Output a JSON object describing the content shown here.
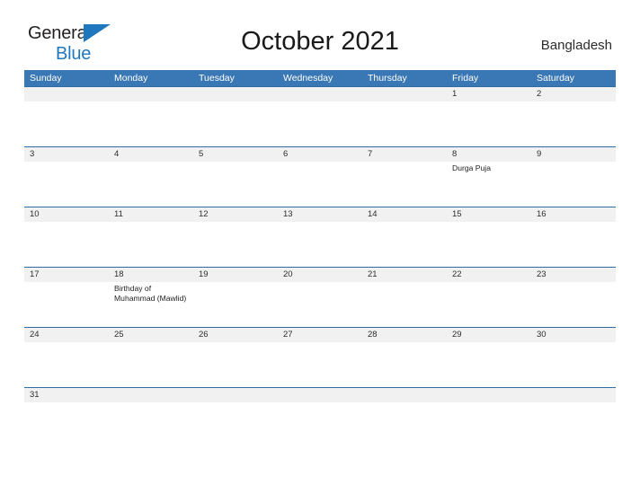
{
  "brand": {
    "word1": "General",
    "word2": "Blue",
    "flag_icon": "blue-triangle-flag"
  },
  "header": {
    "title": "October 2021",
    "country": "Bangladesh"
  },
  "colors": {
    "header_blue": "#3a77b5",
    "row_border_blue": "#2e6da4",
    "number_strip_gray": "#f1f1f1",
    "logo_blue": "#1f77bd"
  },
  "calendar": {
    "weekdays": [
      "Sunday",
      "Monday",
      "Tuesday",
      "Wednesday",
      "Thursday",
      "Friday",
      "Saturday"
    ],
    "weeks": [
      [
        {
          "day": ""
        },
        {
          "day": ""
        },
        {
          "day": ""
        },
        {
          "day": ""
        },
        {
          "day": ""
        },
        {
          "day": "1",
          "event": ""
        },
        {
          "day": "2",
          "event": ""
        }
      ],
      [
        {
          "day": "3",
          "event": ""
        },
        {
          "day": "4",
          "event": ""
        },
        {
          "day": "5",
          "event": ""
        },
        {
          "day": "6",
          "event": ""
        },
        {
          "day": "7",
          "event": ""
        },
        {
          "day": "8",
          "event": "Durga Puja"
        },
        {
          "day": "9",
          "event": ""
        }
      ],
      [
        {
          "day": "10",
          "event": ""
        },
        {
          "day": "11",
          "event": ""
        },
        {
          "day": "12",
          "event": ""
        },
        {
          "day": "13",
          "event": ""
        },
        {
          "day": "14",
          "event": ""
        },
        {
          "day": "15",
          "event": ""
        },
        {
          "day": "16",
          "event": ""
        }
      ],
      [
        {
          "day": "17",
          "event": ""
        },
        {
          "day": "18",
          "event": "Birthday of Muhammad (Mawlid)"
        },
        {
          "day": "19",
          "event": ""
        },
        {
          "day": "20",
          "event": ""
        },
        {
          "day": "21",
          "event": ""
        },
        {
          "day": "22",
          "event": ""
        },
        {
          "day": "23",
          "event": ""
        }
      ],
      [
        {
          "day": "24",
          "event": ""
        },
        {
          "day": "25",
          "event": ""
        },
        {
          "day": "26",
          "event": ""
        },
        {
          "day": "27",
          "event": ""
        },
        {
          "day": "28",
          "event": ""
        },
        {
          "day": "29",
          "event": ""
        },
        {
          "day": "30",
          "event": ""
        }
      ],
      [
        {
          "day": "31",
          "event": ""
        },
        {
          "day": ""
        },
        {
          "day": ""
        },
        {
          "day": ""
        },
        {
          "day": ""
        },
        {
          "day": ""
        },
        {
          "day": ""
        }
      ]
    ]
  }
}
